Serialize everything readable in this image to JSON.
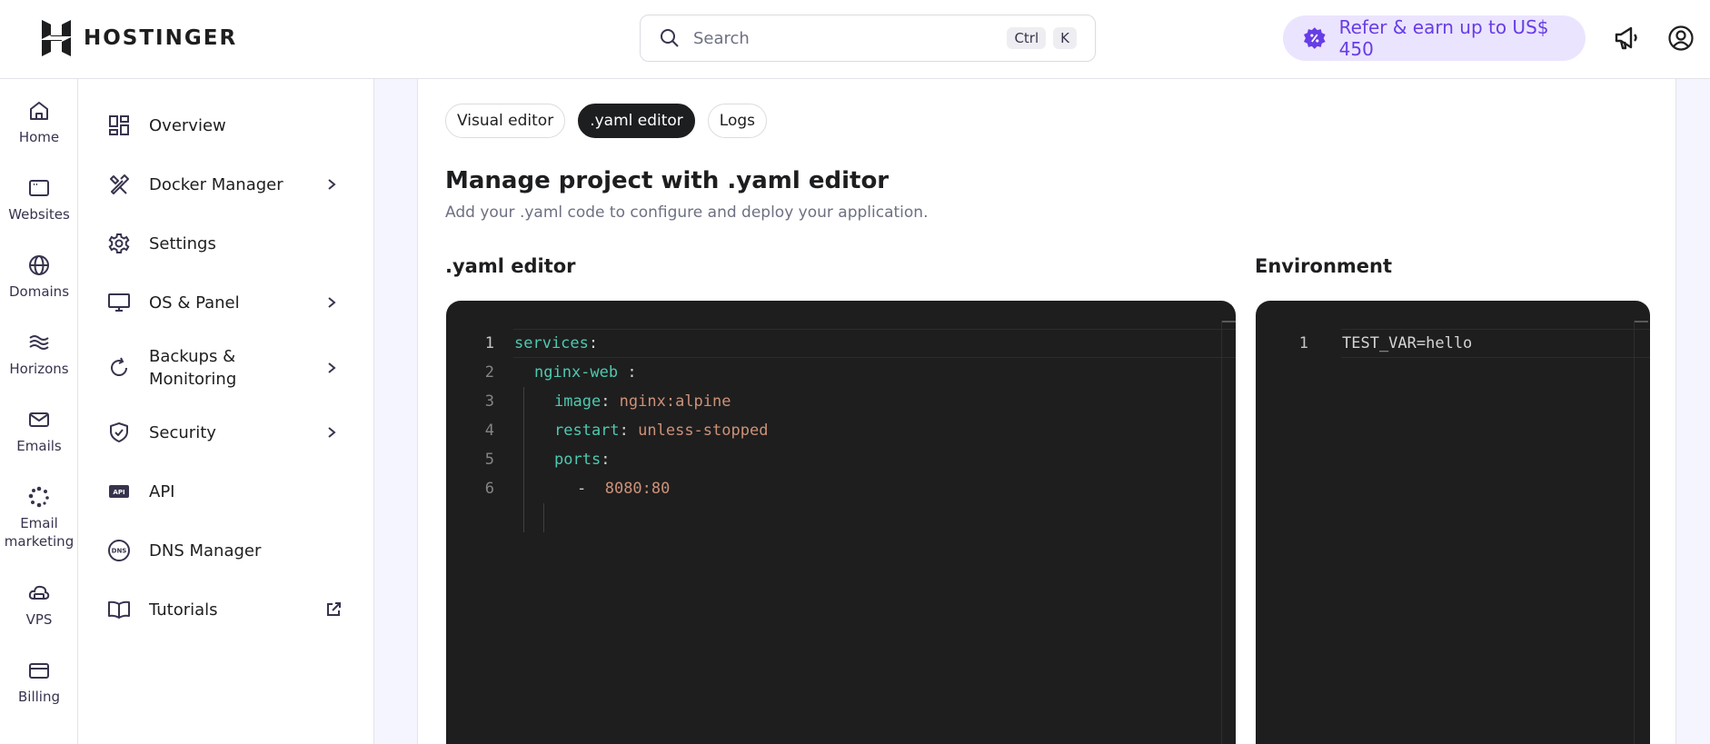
{
  "header": {
    "logo_text": "HOSTINGER",
    "search_placeholder": "Search",
    "shortcut_ctrl": "Ctrl",
    "shortcut_k": "K",
    "refer_label": "Refer & earn up to US$ 450"
  },
  "rail": {
    "items": [
      {
        "label": "Home",
        "icon": "home-icon"
      },
      {
        "label": "Websites",
        "icon": "websites-icon"
      },
      {
        "label": "Domains",
        "icon": "globe-icon"
      },
      {
        "label": "Horizons",
        "icon": "horizons-icon"
      },
      {
        "label": "Emails",
        "icon": "mail-icon"
      },
      {
        "label": "Email marketing",
        "icon": "email-marketing-icon"
      },
      {
        "label": "VPS",
        "icon": "vps-icon"
      },
      {
        "label": "Billing",
        "icon": "credit-card-icon"
      }
    ]
  },
  "subnav": {
    "items": [
      {
        "label": "Overview",
        "icon": "dashboard-icon",
        "chevron": false
      },
      {
        "label": "Docker Manager",
        "icon": "tools-icon",
        "chevron": true
      },
      {
        "label": "Settings",
        "icon": "gear-icon",
        "chevron": false
      },
      {
        "label": "OS & Panel",
        "icon": "monitor-icon",
        "chevron": true
      },
      {
        "label": "Backups &",
        "label2": "Monitoring",
        "icon": "refresh-icon",
        "chevron": true
      },
      {
        "label": "Security",
        "icon": "shield-icon",
        "chevron": true
      },
      {
        "label": "API",
        "icon": "api-icon",
        "chevron": false
      },
      {
        "label": "DNS Manager",
        "icon": "dns-icon",
        "chevron": false
      },
      {
        "label": "Tutorials",
        "icon": "book-icon",
        "external": true
      }
    ]
  },
  "main": {
    "tabs": [
      {
        "label": "Visual editor",
        "active": false
      },
      {
        "label": ".yaml editor",
        "active": true
      },
      {
        "label": "Logs",
        "active": false
      }
    ],
    "title": "Manage project with .yaml editor",
    "subtitle": "Add your .yaml code to configure and deploy your application.",
    "yaml_heading": ".yaml editor",
    "env_heading": "Environment"
  },
  "yaml_editor": {
    "lines": [
      {
        "n": "1",
        "key": "services",
        "sep": ":",
        "value": ""
      },
      {
        "n": "2",
        "key": "nginx-web",
        "sep": " :",
        "value": ""
      },
      {
        "n": "3",
        "key": "image",
        "sep": ": ",
        "value": "nginx:alpine"
      },
      {
        "n": "4",
        "key": "restart",
        "sep": ": ",
        "value": "unless-stopped"
      },
      {
        "n": "5",
        "key": "ports",
        "sep": ":",
        "value": ""
      },
      {
        "n": "6",
        "key": "",
        "sep": "-  ",
        "value": "8080:80"
      }
    ]
  },
  "env_editor": {
    "lines": [
      {
        "n": "1",
        "text": "TEST_VAR=hello"
      }
    ]
  },
  "colors": {
    "brand": "#673de6",
    "refer_bg": "#ebe4ff",
    "editor_bg": "#1e1e1e",
    "yaml_key": "#4ec9b0",
    "yaml_value": "#ce9178"
  }
}
